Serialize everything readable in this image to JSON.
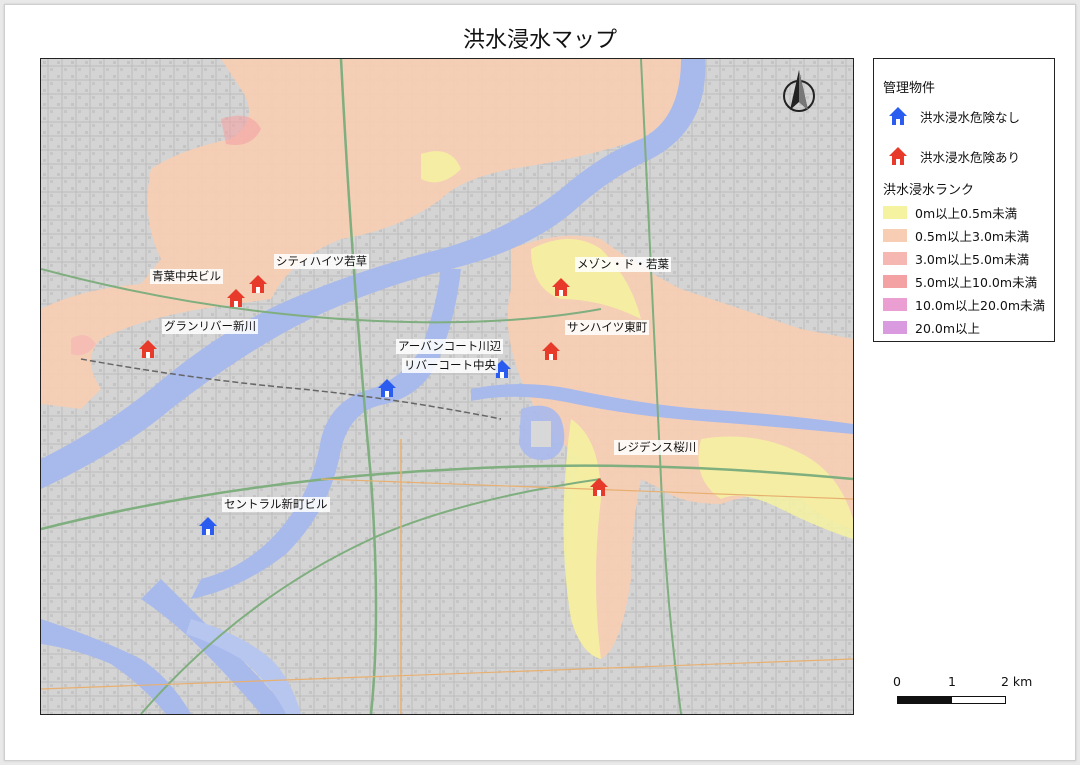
{
  "title": "洪水浸水マップ",
  "legend": {
    "properties_heading": "管理物件",
    "safe_label": "洪水浸水危険なし",
    "risk_label": "洪水浸水危険あり",
    "rank_heading": "洪水浸水ランク",
    "ranks": [
      {
        "label": "0m以上0.5m未満",
        "color": "#f5f2a0"
      },
      {
        "label": "0.5m以上3.0m未満",
        "color": "#f7cdb3"
      },
      {
        "label": "3.0m以上5.0m未満",
        "color": "#f6b7b3"
      },
      {
        "label": "5.0m以上10.0m未満",
        "color": "#f3a1a3"
      },
      {
        "label": "10.0m以上20.0m未満",
        "color": "#ea9ed2"
      },
      {
        "label": "20.0m以上",
        "color": "#d99ae0"
      }
    ]
  },
  "colors": {
    "safe_marker": "#2a5cf0",
    "risk_marker": "#e83a2a",
    "river": "#a8b9ec",
    "base_map": "#d9d9d9"
  },
  "properties": [
    {
      "name": "青葉中央ビル",
      "risk": true
    },
    {
      "name": "シティハイツ若草",
      "risk": true
    },
    {
      "name": "グランリバー新川",
      "risk": true
    },
    {
      "name": "メゾン・ド・若葉",
      "risk": true
    },
    {
      "name": "サンハイツ東町",
      "risk": true
    },
    {
      "name": "アーバンコート川辺",
      "risk": false
    },
    {
      "name": "リバーコート中央",
      "risk": false
    },
    {
      "name": "レジデンス桜川",
      "risk": true
    },
    {
      "name": "セントラル新町ビル",
      "risk": false
    }
  ],
  "scale_bar": {
    "ticks": [
      "0",
      "1",
      "2 km"
    ]
  },
  "north_arrow_icon": "north-arrow-icon"
}
